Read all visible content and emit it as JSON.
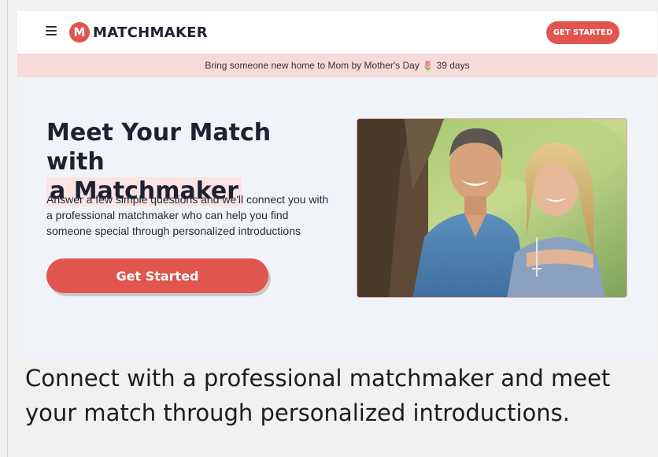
{
  "header": {
    "logo_mark": "M",
    "logo_text": "MATCHMAKER",
    "cta_label": "GET STARTED"
  },
  "promo": {
    "text": "Bring someone new home to Mom by Mother's Day",
    "days": "39 days"
  },
  "hero": {
    "headline_line1": "Meet Your Match with",
    "headline_line2": "a Matchmaker",
    "subcopy": "Answer a few simple questions and we'll connect you with a professional matchmaker who can help you find someone special through personalized introductions",
    "cta_label": "Get Started",
    "photo_icon": "couple-photo"
  },
  "caption": "Connect with a professional matchmaker and meet your match through personalized introductions.",
  "colors": {
    "accent": "#e0564f",
    "promo_bg": "#f7dada",
    "hero_bg": "#f0f4f8"
  }
}
